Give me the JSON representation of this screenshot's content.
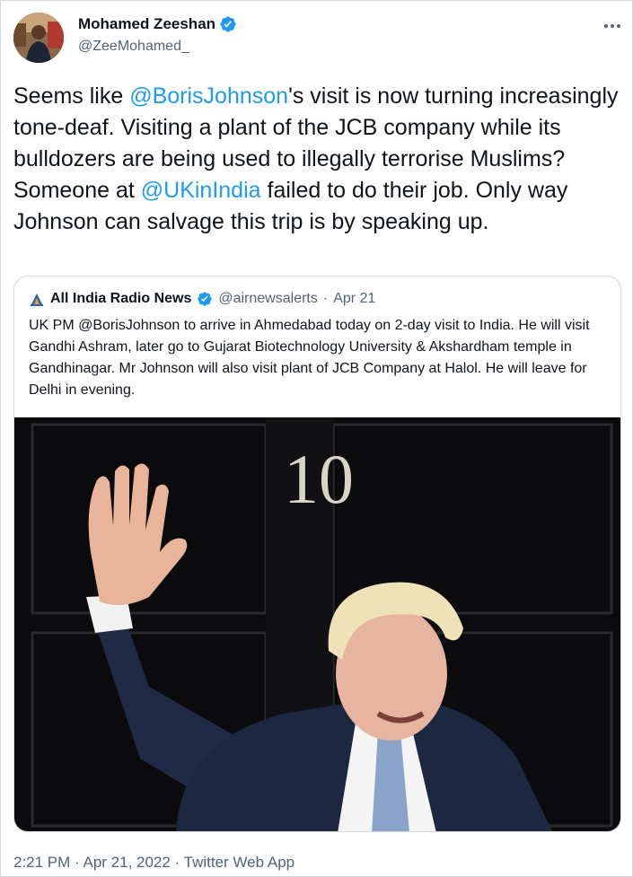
{
  "author": {
    "name": "Mohamed Zeeshan",
    "handle": "@ZeeMohamed_",
    "verified_icon": "verified-badge-icon"
  },
  "tweet": {
    "text_parts": [
      "Seems like ",
      "@BorisJohnson",
      "'s visit is now turning increasingly tone-deaf. Visiting a plant of the JCB company while its bulldozers are being used to illegally terrorise Muslims? Someone at ",
      "@UKinIndia",
      " failed to do their job. Only way Johnson can salvage this trip is by speaking up."
    ]
  },
  "quoted": {
    "name": "All India Radio News",
    "handle": "@airnewsalerts",
    "separator": "·",
    "date": "Apr 21",
    "text": "UK PM @BorisJohnson to arrive in Ahmedabad today on 2-day visit to India. He will visit Gandhi Ashram, later go to Gujarat Biotechnology University & Akshardham temple in Gandhinagar. Mr Johnson will also visit plant of JCB Company at Halol. He will leave for Delhi in evening.",
    "photo_door_number": "10"
  },
  "footer": {
    "text": "2:21 PM · Apr 21, 2022 · Twitter Web App"
  },
  "colors": {
    "link": "#1d9bf0",
    "secondary_text": "#536471",
    "border": "#cfd9de",
    "primary_text": "#0f1419"
  }
}
